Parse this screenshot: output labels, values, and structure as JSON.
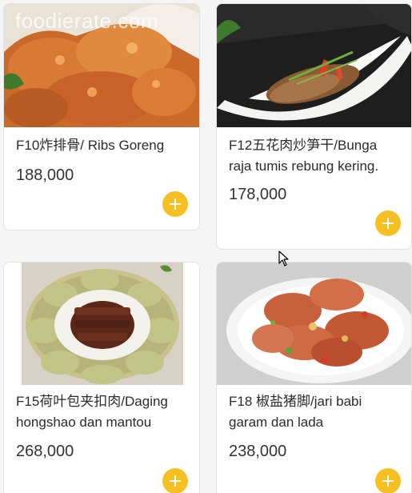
{
  "watermark": "foodierate.com",
  "theme": {
    "accent": "#f6c023",
    "card_bg": "#ffffff",
    "page_bg": "#f5f5f5"
  },
  "icons": {
    "add": "plus-icon",
    "pointer": "mouse-cursor-icon"
  },
  "menu": {
    "items": [
      {
        "name": "F10炸排骨/ Ribs Goreng",
        "price": "188,000",
        "image": "fried-ribs-photo"
      },
      {
        "name": "F12五花肉炒笋干/Bunga raja tumis rebung kering.",
        "price": "178,000",
        "image": "pork-bamboo-shoots-photo"
      },
      {
        "name": "F15荷叶包夹扣肉/Daging hongshao dan mantou",
        "price": "268,000",
        "image": "braised-pork-lotus-bun-photo"
      },
      {
        "name": "F18 椒盐猪脚/jari babi garam dan lada",
        "price": "238,000",
        "image": "salt-pepper-pork-trotter-photo"
      }
    ]
  }
}
